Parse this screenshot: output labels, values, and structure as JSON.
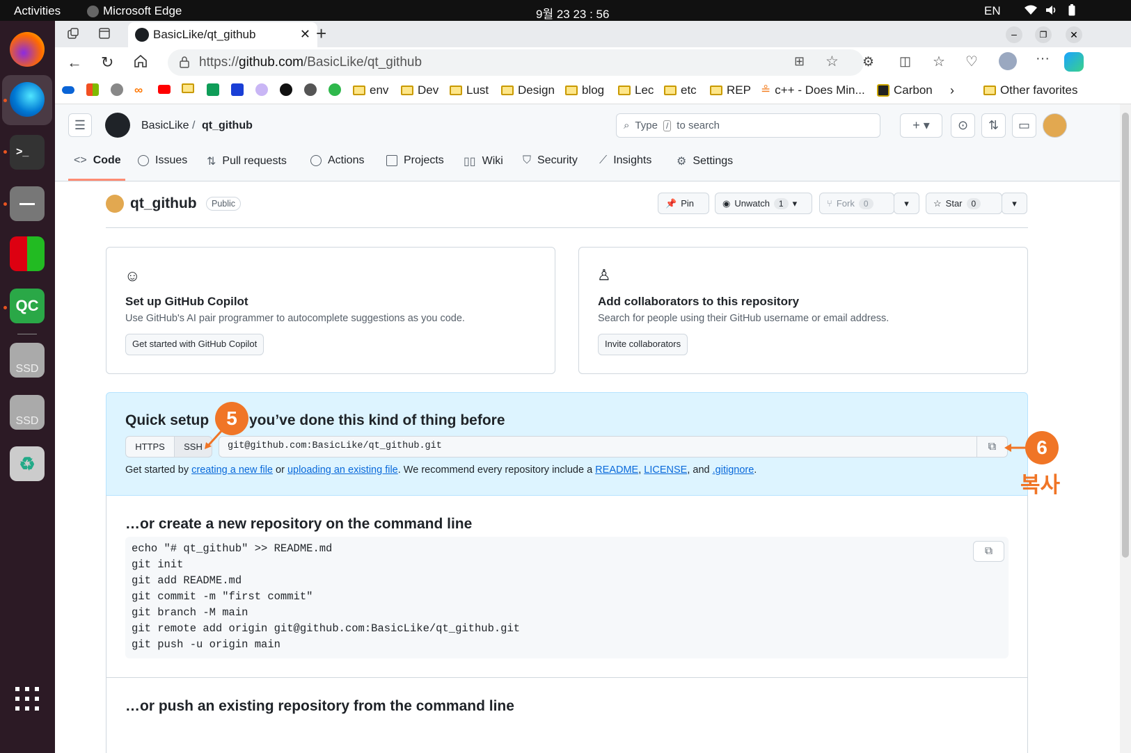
{
  "os": {
    "activities": "Activities",
    "app_name": "Microsoft Edge",
    "clock": "9월 23  23 : 56",
    "lang": "EN"
  },
  "dock": {
    "qc_label": "QC",
    "ssd1": "SSD",
    "ssd2": "SSD"
  },
  "browser": {
    "tab_title": "BasicLike/qt_github",
    "url_prefix": "https://",
    "url_host": "github.com",
    "url_path": "/BasicLike/qt_github"
  },
  "favorites": [
    {
      "label": "env"
    },
    {
      "label": "Dev"
    },
    {
      "label": "Lust"
    },
    {
      "label": "Design"
    },
    {
      "label": "blog"
    },
    {
      "label": "Lec"
    },
    {
      "label": "etc"
    },
    {
      "label": "REP"
    },
    {
      "label": "c++ - Does Min..."
    },
    {
      "label": "Carbon"
    }
  ],
  "other_favorites": "Other favorites",
  "github": {
    "owner": "BasicLike",
    "slash": "/",
    "repo": "qt_github",
    "search_pre": "Type",
    "search_key": "/",
    "search_post": "to search",
    "tabs": [
      "Code",
      "Issues",
      "Pull requests",
      "Actions",
      "Projects",
      "Wiki",
      "Security",
      "Insights",
      "Settings"
    ],
    "repo_title": "qt_github",
    "visibility": "Public",
    "pin": "Pin",
    "unwatch": "Unwatch",
    "watch_count": "1",
    "fork": "Fork",
    "fork_count": "0",
    "star": "Star",
    "star_count": "0",
    "copilot": {
      "title": "Set up GitHub Copilot",
      "desc": "Use GitHub's AI pair programmer to autocomplete suggestions as you code.",
      "button": "Get started with GitHub Copilot"
    },
    "collab": {
      "title": "Add collaborators to this repository",
      "desc": "Search for people using their GitHub username or email address.",
      "button": "Invite collaborators"
    },
    "quick": {
      "title_a": "Quick setup",
      "title_b": "you’ve done this kind of thing before",
      "https": "HTTPS",
      "ssh": "SSH",
      "clone_url": "git@github.com:BasicLike/qt_github.git",
      "t1": "Get started by ",
      "l1": "creating a new file",
      "t2": " or ",
      "l2": "uploading an existing file",
      "t3": ". We recommend every repository include a ",
      "l3": "README",
      "t4": ", ",
      "l4": "LICENSE",
      "t5": ", and ",
      "l5": ".gitignore",
      "t6": "."
    },
    "cmd_title": "…or create a new repository on the command line",
    "commands": [
      "echo \"# qt_github\" >> README.md",
      "git init",
      "git add README.md",
      "git commit -m \"first commit\"",
      "git branch -M main",
      "git remote add origin git@github.com:BasicLike/qt_github.git",
      "git push -u origin main"
    ],
    "push_title": "…or push an existing repository from the command line"
  },
  "annotations": {
    "badge5": "5",
    "badge6": "6",
    "copy_label": "복사",
    "accent": "#f07526"
  }
}
